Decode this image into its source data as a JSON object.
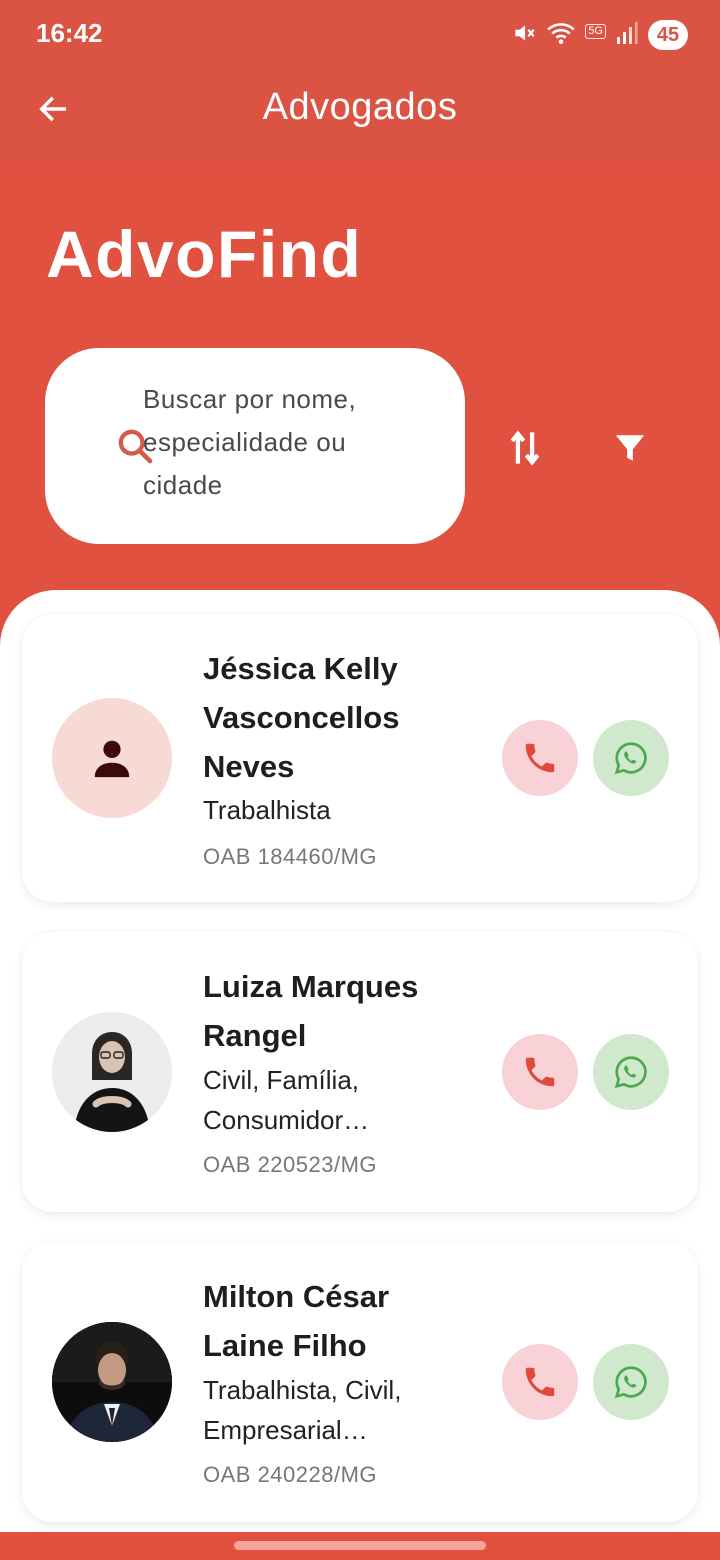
{
  "status_bar": {
    "time": "16:42",
    "network": "5G",
    "battery": "45",
    "icons": [
      "mute-icon",
      "wifi-icon",
      "signal-icon",
      "battery-icon"
    ]
  },
  "app_bar": {
    "title": "Advogados",
    "back_icon": "arrow-left-icon"
  },
  "brand": "AdvoFind",
  "search": {
    "placeholder": "Buscar por nome, especialidade ou cidade",
    "icon": "search-icon"
  },
  "tools": {
    "sort_icon": "sort-arrows-icon",
    "filter_icon": "filter-funnel-icon"
  },
  "lawyers": [
    {
      "name": "Jéssica Kelly Vasconcellos Neves",
      "specialties": "Trabalhista",
      "oab": "OAB 184460/MG",
      "avatar": "person-placeholder-icon"
    },
    {
      "name": "Luiza Marques Rangel",
      "specialties": "Civil, Família, Consumidor…",
      "oab": "OAB 220523/MG",
      "avatar": "photo"
    },
    {
      "name": "Milton César Laine Filho",
      "specialties": "Trabalhista, Civil, Empresarial…",
      "oab": "OAB 240228/MG",
      "avatar": "photo"
    }
  ],
  "colors": {
    "primary": "#E05140",
    "app_bar": "#DA5343",
    "call_button_bg": "#F8D2D6",
    "call_icon": "#E04A3A",
    "whatsapp_button_bg": "#D0E9CD",
    "whatsapp_icon": "#4CA852"
  }
}
